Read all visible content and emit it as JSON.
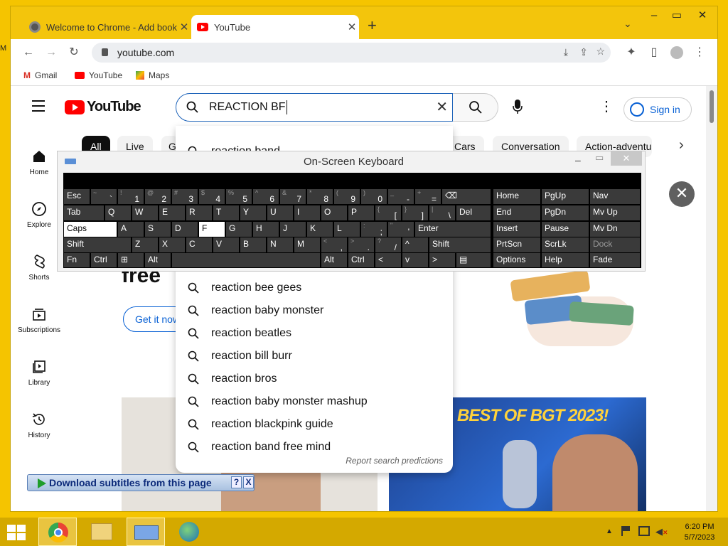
{
  "browser": {
    "tabs": [
      {
        "title": "Welcome to Chrome - Add book"
      },
      {
        "title": "YouTube"
      }
    ],
    "url": "youtube.com",
    "bookmarks": [
      "Gmail",
      "YouTube",
      "Maps"
    ]
  },
  "youtube": {
    "logo_text": "YouTube",
    "search_value": "REACTION BF",
    "signin_label": "Sign in",
    "chips": [
      "All",
      "Live",
      "G",
      "Cars",
      "Conversation",
      "Action-adventu"
    ],
    "sidebar": [
      {
        "label": "Home"
      },
      {
        "label": "Explore"
      },
      {
        "label": "Shorts"
      },
      {
        "label": "Subscriptions"
      },
      {
        "label": "Library"
      },
      {
        "label": "History"
      }
    ],
    "suggestions": [
      {
        "prefix": "reaction ",
        "rest": "band"
      },
      {
        "prefix": "reaction ",
        "rest": "bee gees"
      },
      {
        "prefix": "reaction ",
        "rest": "baby monster"
      },
      {
        "prefix": "reaction ",
        "rest": "beatles"
      },
      {
        "prefix": "reaction ",
        "rest": "bill burr"
      },
      {
        "prefix": "reaction ",
        "rest": "bros"
      },
      {
        "prefix": "reaction ",
        "rest": "baby monster mashup"
      },
      {
        "prefix": "reaction ",
        "rest": "blackpink guide"
      },
      {
        "prefix": "reaction ",
        "rest": "band free mind"
      }
    ],
    "report_label": "Report search predictions",
    "promo_word": "free",
    "get_it_now": "Get it now",
    "thumb_text": "BEST OF BGT 2023!"
  },
  "osk": {
    "title": "On-Screen Keyboard",
    "minimize": "–",
    "restore": "▭",
    "close": "✕"
  },
  "download_bar": {
    "label": "Download subtitles from this page",
    "help": "?",
    "close": "X"
  },
  "taskbar": {
    "time": "6:20 PM",
    "date": "5/7/2023"
  },
  "colors": {
    "desktop": "#f5c400",
    "titlebar": "#f3c50c",
    "youtube_red": "#ff0000",
    "link_blue": "#065fd4"
  }
}
